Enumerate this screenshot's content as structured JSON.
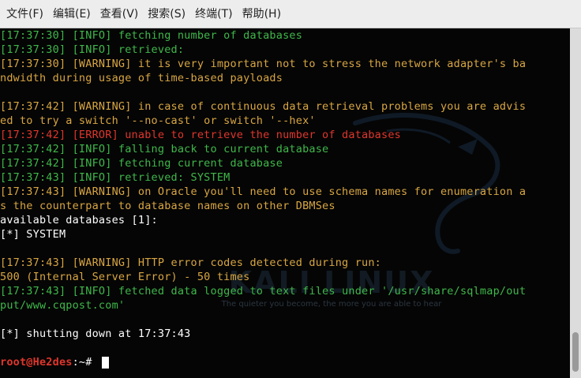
{
  "menubar": {
    "items": [
      "文件(F)",
      "编辑(E)",
      "查看(V)",
      "搜索(S)",
      "终端(T)",
      "帮助(H)"
    ]
  },
  "background": {
    "logo_text": "KALI LINUX",
    "tagline": "The quieter you become, the more you are able to hear"
  },
  "terminal": {
    "lines": [
      {
        "type": "info",
        "text": "[17:37:30] [INFO] fetching number of databases"
      },
      {
        "type": "info",
        "text": "[17:37:30] [INFO] retrieved:"
      },
      {
        "type": "warn",
        "text": "[17:37:30] [WARNING] it is very important not to stress the network adapter's ba"
      },
      {
        "type": "warn",
        "text": "ndwidth during usage of time-based payloads"
      },
      {
        "type": "blank",
        "text": ""
      },
      {
        "type": "warn",
        "text": "[17:37:42] [WARNING] in case of continuous data retrieval problems you are advis"
      },
      {
        "type": "warn",
        "text": "ed to try a switch '--no-cast' or switch '--hex'"
      },
      {
        "type": "err",
        "text": "[17:37:42] [ERROR] unable to retrieve the number of databases"
      },
      {
        "type": "info",
        "text": "[17:37:42] [INFO] falling back to current database"
      },
      {
        "type": "info",
        "text": "[17:37:42] [INFO] fetching current database"
      },
      {
        "type": "info",
        "text": "[17:37:43] [INFO] retrieved: SYSTEM"
      },
      {
        "type": "warn",
        "text": "[17:37:43] [WARNING] on Oracle you'll need to use schema names for enumeration a"
      },
      {
        "type": "warn",
        "text": "s the counterpart to database names on other DBMSes"
      },
      {
        "type": "plain",
        "text": "available databases [1]:"
      },
      {
        "type": "plain",
        "text": "[*] SYSTEM"
      },
      {
        "type": "blank",
        "text": ""
      },
      {
        "type": "warn",
        "text": "[17:37:43] [WARNING] HTTP error codes detected during run:"
      },
      {
        "type": "warn",
        "text": "500 (Internal Server Error) - 50 times"
      },
      {
        "type": "info",
        "text": "[17:37:43] [INFO] fetched data logged to text files under '/usr/share/sqlmap/out"
      },
      {
        "type": "info",
        "text": "put/www.cqpost.com'"
      },
      {
        "type": "blank",
        "text": ""
      },
      {
        "type": "plain",
        "text": "[*] shutting down at 17:37:43"
      },
      {
        "type": "blank",
        "text": ""
      }
    ],
    "prompt_user": "root@He2des",
    "prompt_rest": ":~# "
  },
  "colors": {
    "info": "#3fb84a",
    "warning": "#d8a642",
    "error": "#e0362c",
    "background": "#050505"
  }
}
